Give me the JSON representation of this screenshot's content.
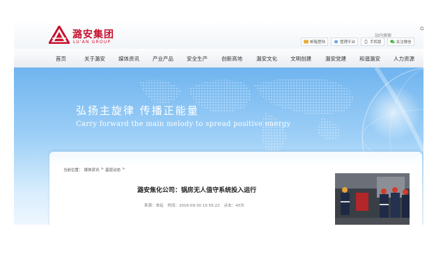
{
  "logo": {
    "name_cn": "潞安集团",
    "name_en": "LU'AN GROUP"
  },
  "search": {
    "label": "站内搜索"
  },
  "toolbar": [
    {
      "label": "邮箱登陆",
      "icon": "mail-icon"
    },
    {
      "label": "管理平台",
      "icon": "globe-icon"
    },
    {
      "label": "手机版",
      "icon": "phone-icon"
    },
    {
      "label": "关注微信",
      "icon": "wechat-icon"
    }
  ],
  "nav": [
    "首页",
    "关于潞安",
    "媒体资讯",
    "产业产品",
    "安全生产",
    "创新高地",
    "潞安文化",
    "文明创建",
    "潞安党建",
    "和谐潞安",
    "人力资源"
  ],
  "banner": {
    "slogan_cn": "弘扬主旋律   传播正能量",
    "slogan_en": "Carry forward the main melody to spread positive energy"
  },
  "breadcrumb": {
    "prefix": "当前位置：",
    "level1": "媒体资讯",
    "sep": ">",
    "level2": "基层动态",
    "end": ">"
  },
  "article": {
    "title": "潞安焦化公司：锅房无人值守系统投入运行",
    "source": "来源：本站",
    "time": "时间：2016-09-30 15:55:22",
    "clicks": "点击：43次"
  },
  "colors": {
    "brand_red": "#c8102e",
    "banner_blue": "#6fb4ef",
    "nav_text": "#333333"
  }
}
